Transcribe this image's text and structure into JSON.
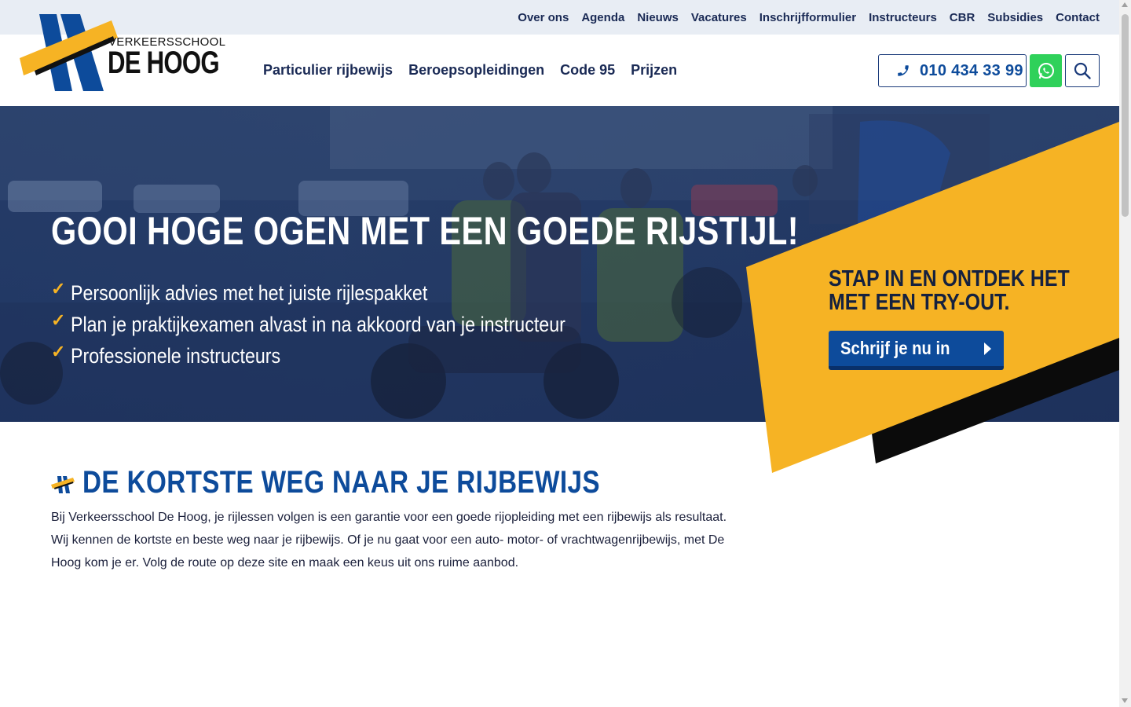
{
  "topnav": {
    "items": [
      {
        "label": "Over ons"
      },
      {
        "label": "Agenda"
      },
      {
        "label": "Nieuws"
      },
      {
        "label": "Vacatures"
      },
      {
        "label": "Inschrijfformulier"
      },
      {
        "label": "Instructeurs"
      },
      {
        "label": "CBR"
      },
      {
        "label": "Subsidies"
      },
      {
        "label": "Contact"
      }
    ]
  },
  "logo": {
    "line1": "VERKEERSSCHOOL",
    "line2": "DE HOOG"
  },
  "mainnav": {
    "items": [
      {
        "label": "Particulier rijbewijs"
      },
      {
        "label": "Beroepsopleidingen"
      },
      {
        "label": "Code 95"
      },
      {
        "label": "Prijzen"
      }
    ]
  },
  "header_actions": {
    "phone": "010 434 33 99",
    "phone_icon": "phone-icon",
    "whatsapp_icon": "whatsapp-icon",
    "search_icon": "search-icon"
  },
  "hero": {
    "title": "GOOI HOGE OGEN MET EEN GOEDE RIJSTIJL!",
    "bullets": [
      {
        "text": "Persoonlijk advies met het juiste rijlespakket"
      },
      {
        "text": "Plan je praktijkexamen alvast in na akkoord van je instructeur"
      },
      {
        "text": "Professionele instructeurs"
      }
    ],
    "check_icon": "checkmark-icon"
  },
  "cta": {
    "title_line1": "STAP IN EN ONTDEK HET",
    "title_line2": "MET EEN TRY-OUT.",
    "button_label": "Schrijf je nu in"
  },
  "intro": {
    "title": "DE KORTSTE WEG NAAR JE RIJBEWIJS",
    "text": "Bij Verkeersschool De Hoog, je rijlessen volgen is een garantie voor een goede rijopleiding met een rijbewijs als resultaat. Wij kennen de kortste en beste weg naar je rijbewijs. Of je nu gaat voor een auto- motor- of vrachtwagenrijbewijs, met De Hoog kom je er. Volg de route op deze site en maak een keus uit ons ruime aanbod."
  },
  "colors": {
    "brand_blue": "#0d4b9b",
    "brand_yellow": "#f6b324",
    "dark_navy": "#1a2a55",
    "whatsapp_green": "#2fd15a"
  }
}
